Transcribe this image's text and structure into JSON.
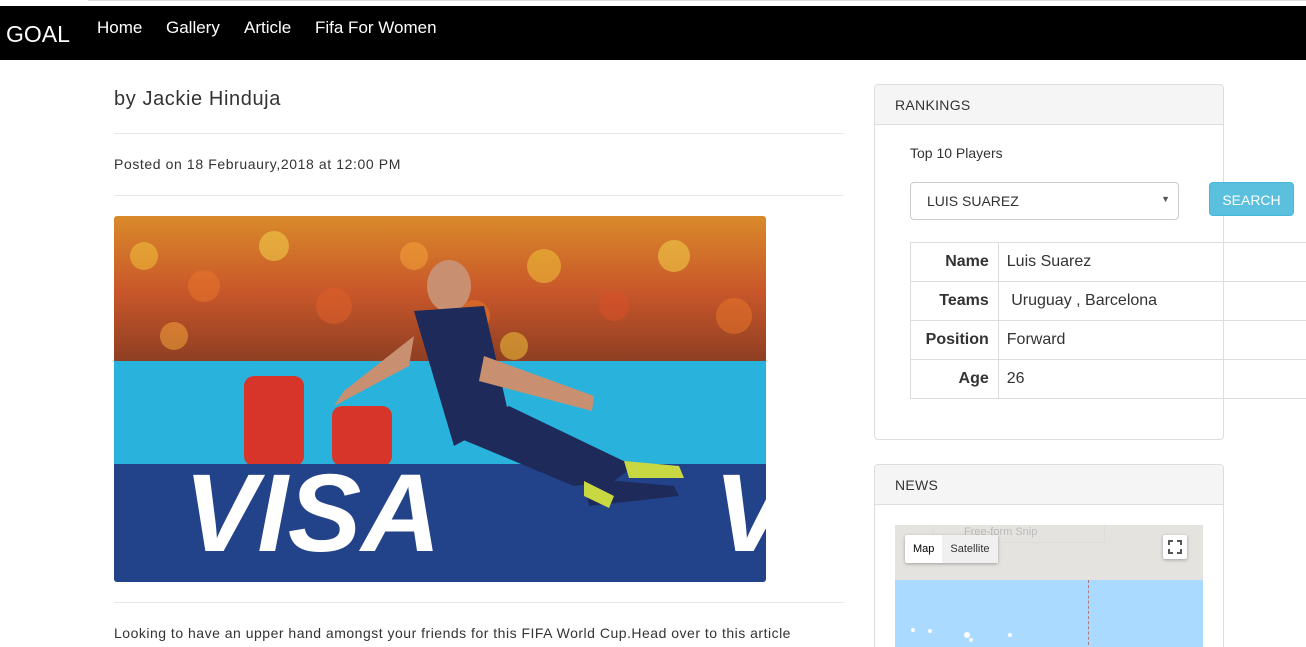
{
  "nav": {
    "brand": "GOAL",
    "links": [
      "Home",
      "Gallery",
      "Article",
      "Fifa For Women"
    ]
  },
  "article": {
    "author": "by Jackie Hinduja",
    "posted": "Posted on 18 Februaury,2018 at 12:00 PM",
    "excerpt": "Looking to have an upper hand amongst your friends for this FIFA World Cup.Head over to this article",
    "image_label": "VISA"
  },
  "rankings": {
    "heading": "RANKINGS",
    "subheading": "Top 10 Players",
    "selected_player": "LUIS SUAREZ",
    "search_label": "SEARCH",
    "rows": [
      {
        "key": "Name",
        "value": "Luis Suarez"
      },
      {
        "key": "Teams",
        "value": " Uruguay , Barcelona"
      },
      {
        "key": "Position",
        "value": "Forward"
      },
      {
        "key": "Age",
        "value": "26"
      }
    ]
  },
  "news": {
    "heading": "NEWS",
    "map_type_map": "Map",
    "map_type_satellite": "Satellite",
    "snip_overlay": "Free-form Snip"
  },
  "colors": {
    "navbar": "#000000",
    "search_button": "#5bc0de",
    "map_water": "#aadaff"
  }
}
